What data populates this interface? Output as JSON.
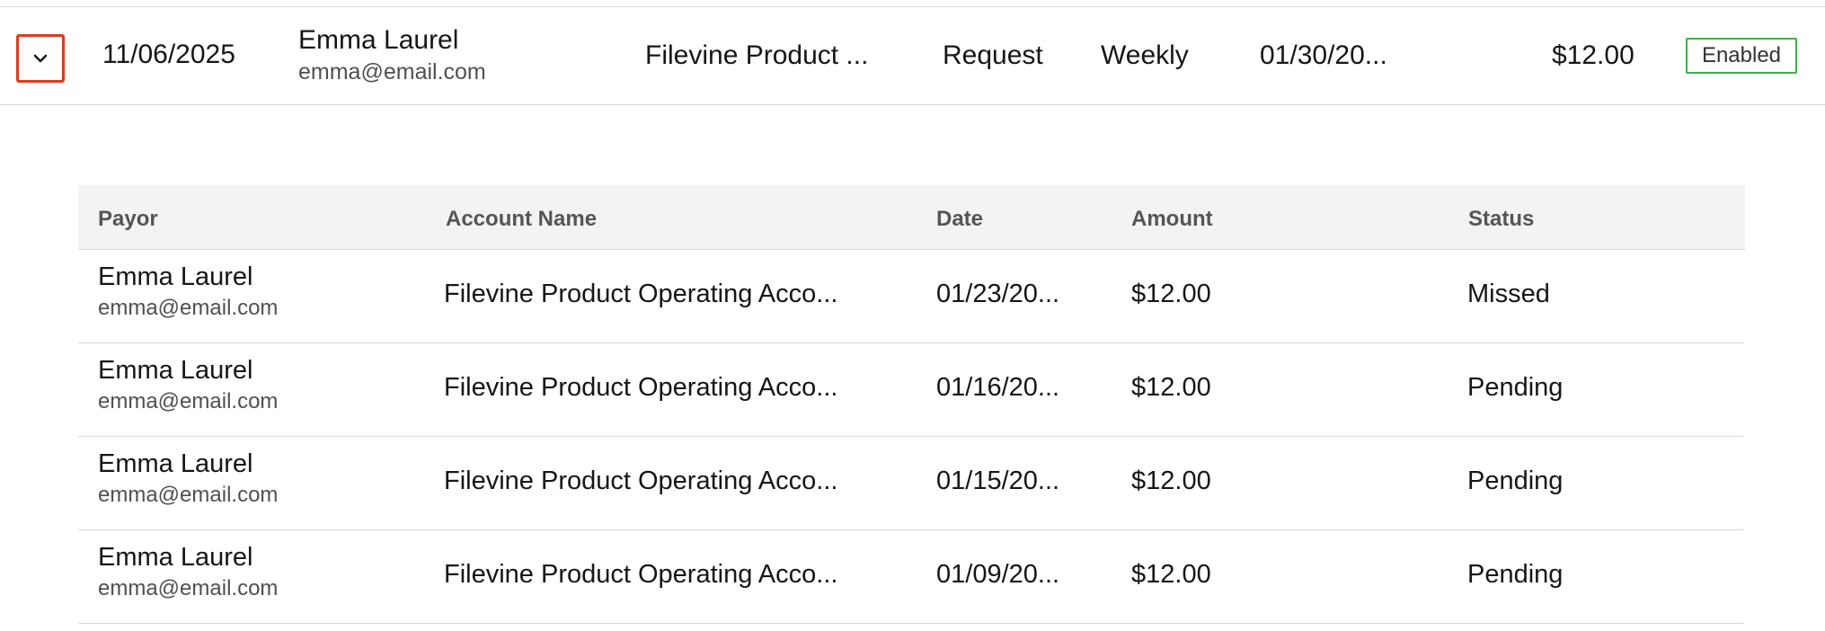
{
  "main_row": {
    "date": "11/06/2025",
    "payor_name": "Emma Laurel",
    "payor_email": "emma@email.com",
    "account": "Filevine Product ...",
    "type": "Request",
    "frequency": "Weekly",
    "next_date": "01/30/20...",
    "amount": "$12.00",
    "status": "Enabled"
  },
  "sub_table": {
    "headers": {
      "payor": "Payor",
      "account_name": "Account Name",
      "date": "Date",
      "amount": "Amount",
      "status": "Status"
    },
    "rows": [
      {
        "payor_name": "Emma Laurel",
        "payor_email": "emma@email.com",
        "account_name": "Filevine Product Operating Acco...",
        "date": "01/23/20...",
        "amount": "$12.00",
        "status": "Missed"
      },
      {
        "payor_name": "Emma Laurel",
        "payor_email": "emma@email.com",
        "account_name": "Filevine Product Operating Acco...",
        "date": "01/16/20...",
        "amount": "$12.00",
        "status": "Pending"
      },
      {
        "payor_name": "Emma Laurel",
        "payor_email": "emma@email.com",
        "account_name": "Filevine Product Operating Acco...",
        "date": "01/15/20...",
        "amount": "$12.00",
        "status": "Pending"
      },
      {
        "payor_name": "Emma Laurel",
        "payor_email": "emma@email.com",
        "account_name": "Filevine Product Operating Acco...",
        "date": "01/09/20...",
        "amount": "$12.00",
        "status": "Pending"
      }
    ]
  },
  "colors": {
    "expand_border": "#e0391f",
    "enabled_border": "#3fae49",
    "header_bg": "#f3f3f3"
  },
  "icons": {
    "expand": "chevron-down-icon"
  }
}
